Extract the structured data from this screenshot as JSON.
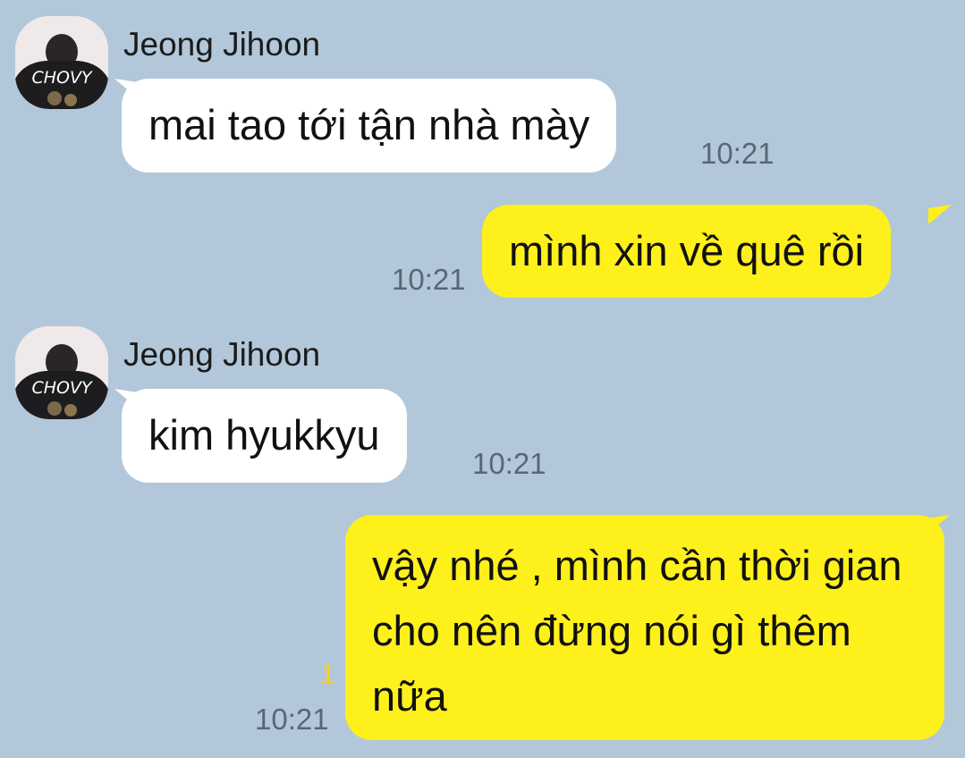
{
  "chat": {
    "messages": [
      {
        "sender": "Jeong Jihoon",
        "direction": "incoming",
        "text": "mai tao tới tận nhà mày",
        "time": "10:21"
      },
      {
        "direction": "outgoing",
        "text": "mình xin về quê rồi",
        "time": "10:21"
      },
      {
        "sender": "Jeong Jihoon",
        "direction": "incoming",
        "text": "kim hyukkyu",
        "time": "10:21"
      },
      {
        "direction": "outgoing",
        "text": "vậy nhé , mình cần thời gian cho nên đừng nói gì thêm nữa",
        "time": "10:21",
        "unread_count": "1"
      }
    ]
  },
  "avatar": {
    "shirt_text": "CHOVY"
  },
  "colors": {
    "background": "#b2c7da",
    "incoming_bubble": "#ffffff",
    "outgoing_bubble": "#fef01b",
    "unread_count": "#f5d21e",
    "time_text": "#5b6673"
  }
}
